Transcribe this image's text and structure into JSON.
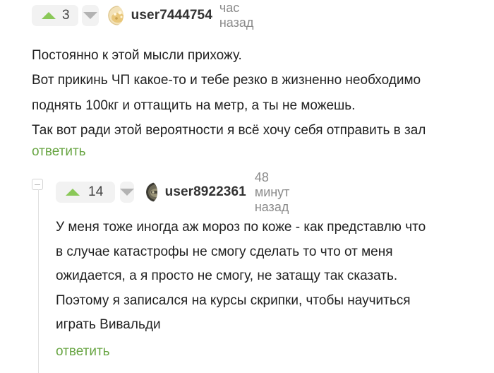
{
  "comments": [
    {
      "votes": "3",
      "username": "user7444754",
      "time": "час назад",
      "lines": [
        "Постоянно к этой мысли прихожу.",
        "Вот прикинь ЧП какое-то и тебе резко в жизненно необходимо",
        "поднять 100кг и оттащить на метр, а ты не можешь.",
        "Так вот ради этой вероятности я всё хочу себя отправить в зал"
      ],
      "reply_label": "ответить"
    },
    {
      "votes": "14",
      "username": "user8922361",
      "time": "48 минут назад",
      "lines": [
        "У меня тоже иногда аж мороз по коже - как представлю что",
        "в случае катастрофы не смогу сделать то что от меня",
        "ожидается, а я просто не смогу, не затащу так сказать.",
        "Поэтому я записался на курсы скрипки, чтобы научиться",
        "играть Вивальди"
      ],
      "reply_label": "ответить"
    }
  ],
  "icons": {
    "upvote": "arrow-up-icon",
    "downvote": "arrow-down-icon",
    "collapse": "minus-icon"
  },
  "colors": {
    "upvote_arrow": "#8ac858",
    "downvote_arrow": "#b3b3b3",
    "reply_link": "#68a543",
    "timestamp": "#8a8a8a",
    "vote_background": "#f2f2f2"
  }
}
